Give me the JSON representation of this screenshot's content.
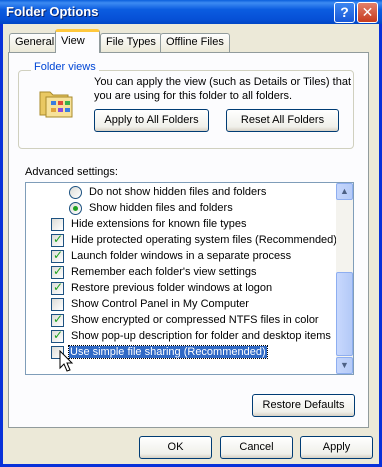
{
  "window": {
    "title": "Folder Options"
  },
  "title_buttons": {
    "help": "?",
    "close": "✕"
  },
  "tabs": [
    {
      "label": "General"
    },
    {
      "label": "View"
    },
    {
      "label": "File Types"
    },
    {
      "label": "Offline Files"
    }
  ],
  "folder_views": {
    "label": "Folder views",
    "description": "You can apply the view (such as Details or Tiles) that you are using for this folder to all folders.",
    "apply_all_label": "Apply to All Folders",
    "reset_all_label": "Reset All Folders",
    "icon": "folder-icon"
  },
  "advanced": {
    "label": "Advanced settings:",
    "items": [
      {
        "type": "radio",
        "checked": false,
        "label": "Do not show hidden files and folders"
      },
      {
        "type": "radio",
        "checked": true,
        "label": "Show hidden files and folders"
      },
      {
        "type": "checkbox",
        "checked": false,
        "label": "Hide extensions for known file types"
      },
      {
        "type": "checkbox",
        "checked": true,
        "label": "Hide protected operating system files (Recommended)"
      },
      {
        "type": "checkbox",
        "checked": true,
        "label": "Launch folder windows in a separate process"
      },
      {
        "type": "checkbox",
        "checked": true,
        "label": "Remember each folder's view settings"
      },
      {
        "type": "checkbox",
        "checked": true,
        "label": "Restore previous folder windows at logon"
      },
      {
        "type": "checkbox",
        "checked": false,
        "label": "Show Control Panel in My Computer"
      },
      {
        "type": "checkbox",
        "checked": true,
        "label": "Show encrypted or compressed NTFS files in color"
      },
      {
        "type": "checkbox",
        "checked": true,
        "label": "Show pop-up description for folder and desktop items"
      },
      {
        "type": "checkbox",
        "checked": false,
        "label": "Use simple file sharing (Recommended)",
        "highlighted": true
      }
    ],
    "restore_defaults_label": "Restore Defaults"
  },
  "footer": {
    "ok_label": "OK",
    "cancel_label": "Cancel",
    "apply_label": "Apply"
  },
  "colors": {
    "title_bar": "#0a5fdc",
    "active_tab_accent": "#ffc83c",
    "selection": "#316ac5",
    "check": "#21a121"
  }
}
